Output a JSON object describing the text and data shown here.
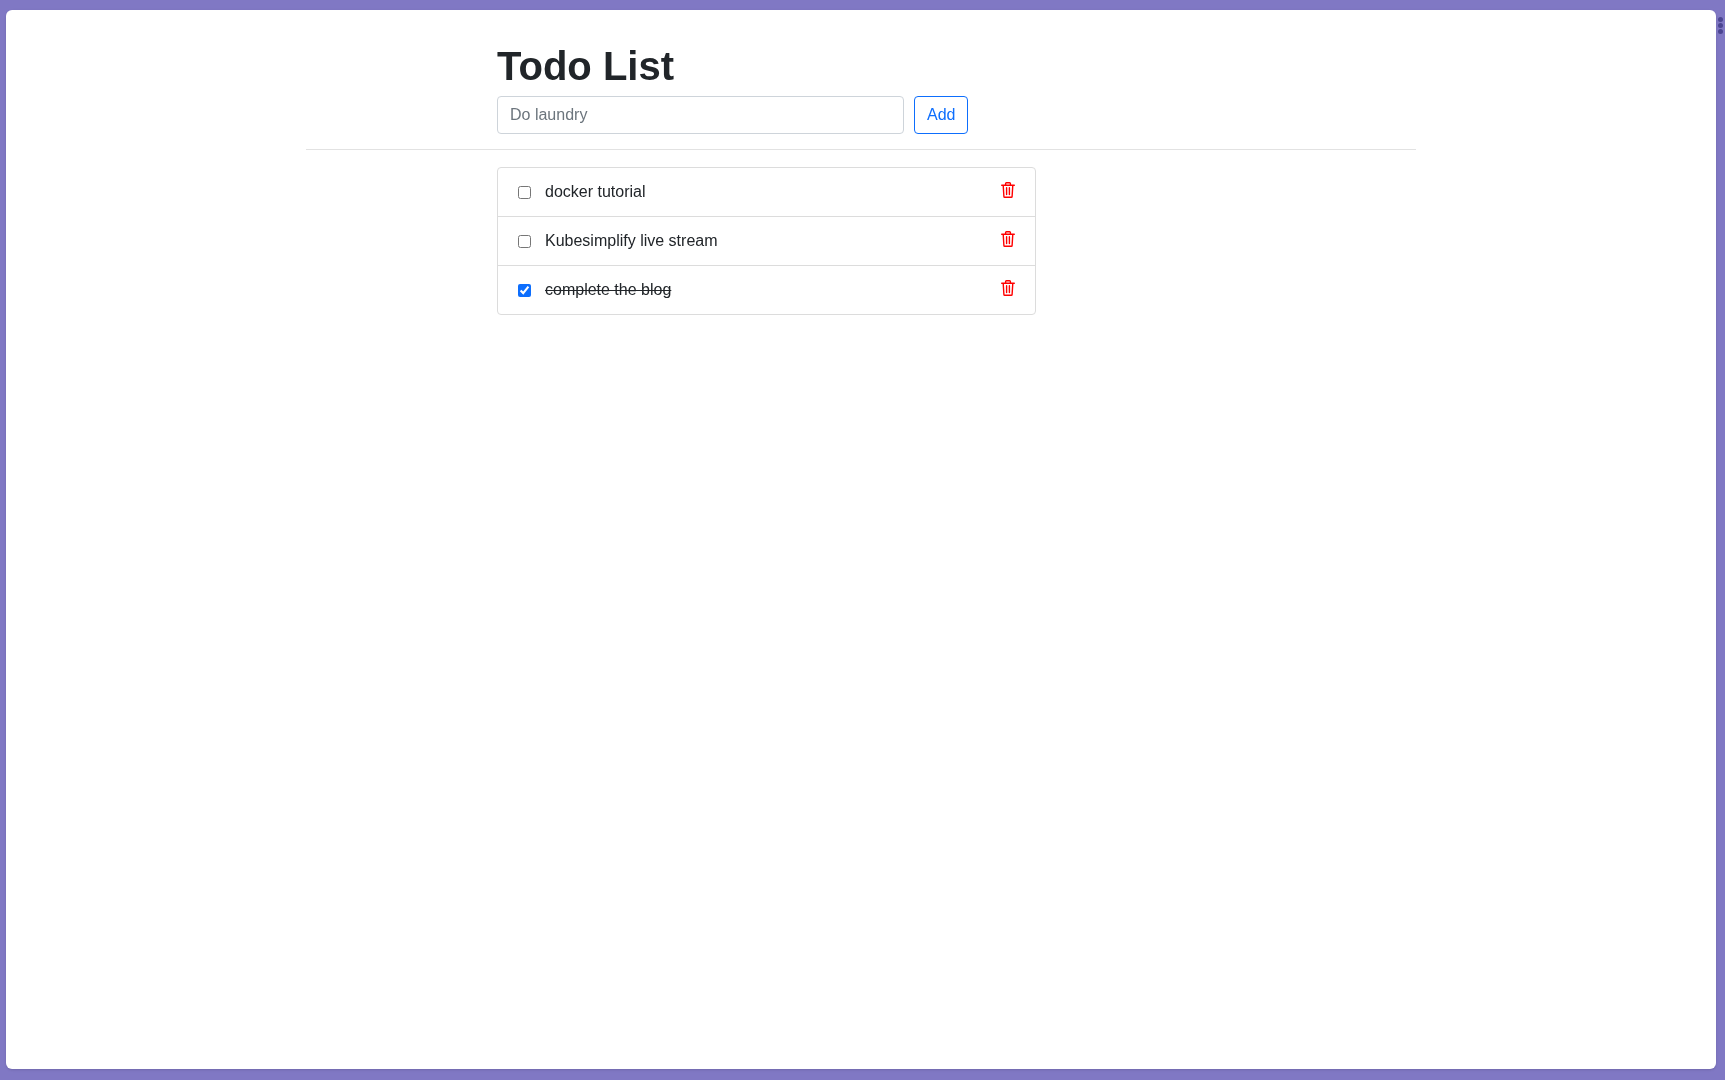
{
  "title": "Todo List",
  "new_todo": {
    "placeholder": "Do laundry"
  },
  "add_button": "Add",
  "todos": [
    {
      "text": "docker tutorial",
      "checked": false
    },
    {
      "text": "Kubesimplify live stream",
      "checked": false
    },
    {
      "text": "complete the blog",
      "checked": true
    }
  ]
}
